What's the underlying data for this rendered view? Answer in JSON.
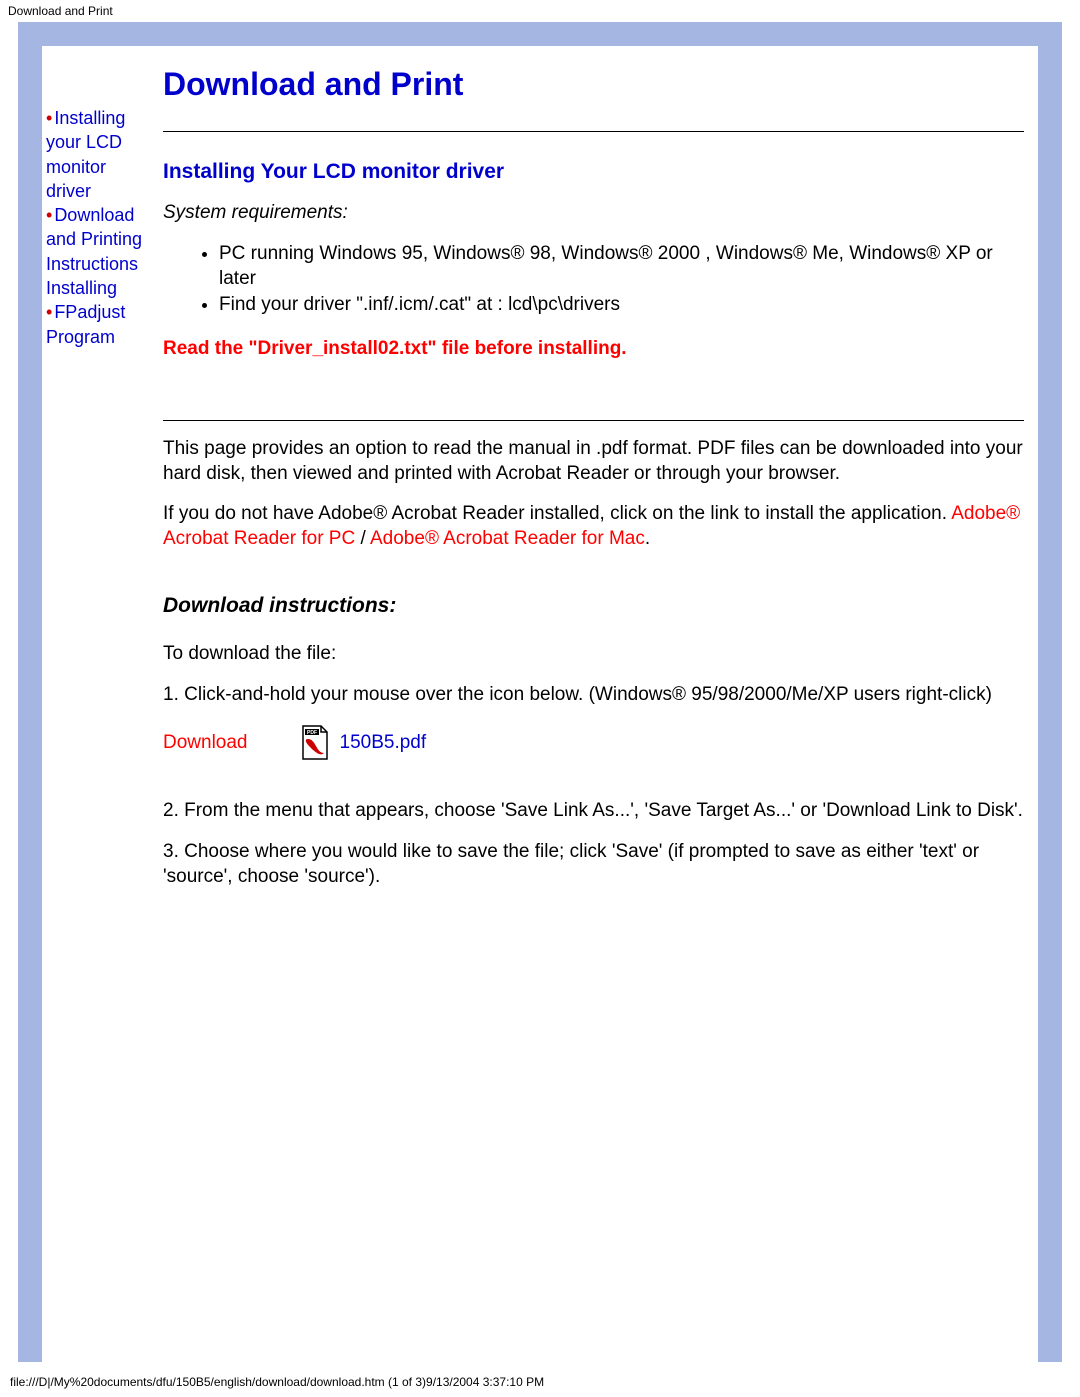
{
  "header": {
    "title": "Download and Print"
  },
  "sidebar": {
    "items": [
      {
        "label": "Installing your LCD monitor driver"
      },
      {
        "label": "Download and Printing Instructions Installing"
      },
      {
        "label": "FPadjust Program"
      }
    ]
  },
  "main": {
    "page_title": "Download and Print",
    "section_title": "Installing Your LCD monitor driver",
    "sysreq_label": "System requirements:",
    "reqs": [
      "PC running Windows 95, Windows® 98, Windows® 2000 , Windows® Me, Windows® XP or later",
      "Find your driver \".inf/.icm/.cat\" at : lcd\\pc\\drivers"
    ],
    "warning": "Read the \"Driver_install02.txt\" file before installing.",
    "para1": "This page provides an option to read the manual in .pdf format. PDF files can be downloaded into your hard disk, then viewed and printed with Acrobat Reader or through your browser.",
    "para2_a": "If you do not have Adobe® Acrobat Reader installed, click on the link to install the application. ",
    "acrobat_pc": "Adobe® Acrobat Reader for PC",
    "slash": " / ",
    "acrobat_mac": "Adobe® Acrobat Reader for Mac",
    "period": ".",
    "dl_heading": "Download instructions:",
    "dl_intro": "To download the file:",
    "step1": "1. Click-and-hold your mouse over the icon below. (Windows® 95/98/2000/Me/XP users right-click)",
    "download_label": "Download",
    "pdf_filename": "150B5.pdf",
    "step2": "2. From the menu that appears, choose 'Save Link As...', 'Save Target As...' or 'Download Link to Disk'.",
    "step3": "3. Choose where you would like to save the file; click 'Save' (if prompted to save as either 'text' or 'source', choose 'source')."
  },
  "footer": {
    "text": "file:///D|/My%20documents/dfu/150B5/english/download/download.htm (1 of 3)9/13/2004 3:37:10 PM"
  }
}
